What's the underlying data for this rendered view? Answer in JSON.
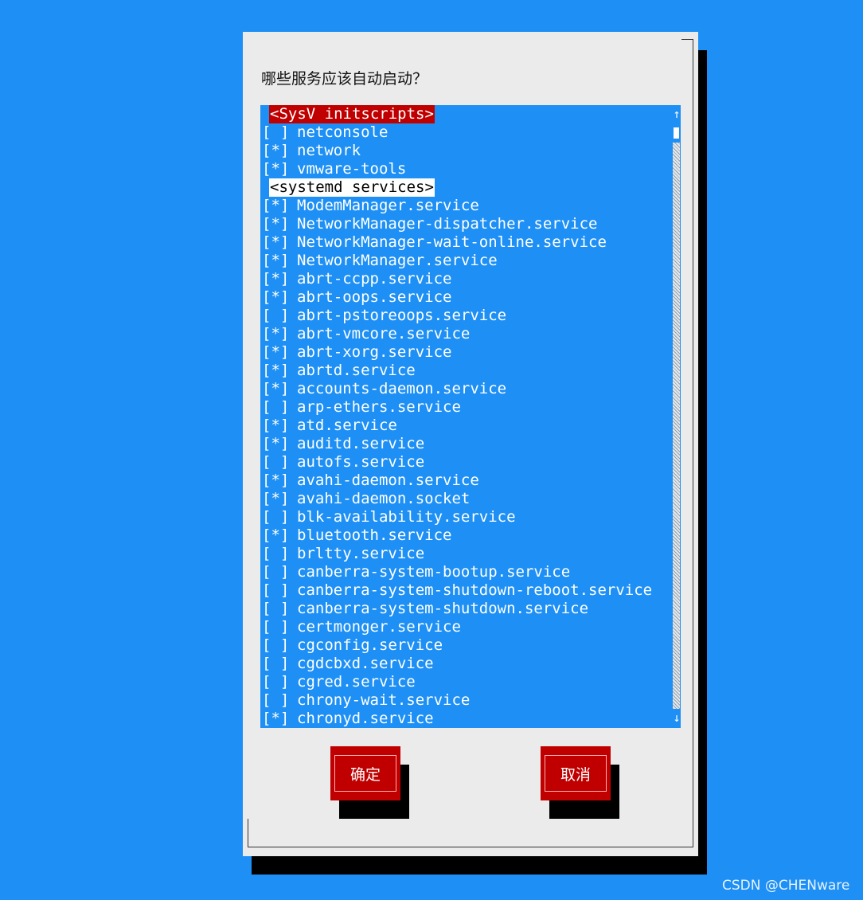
{
  "dialog": {
    "prompt": "哪些服务应该自动启动？",
    "ok_label": "确定",
    "cancel_label": "取消"
  },
  "list": {
    "groups": [
      {
        "label": "<SysV initscripts>",
        "active": true
      },
      {
        "label": "<systemd services>",
        "active": false
      }
    ],
    "sysv_items": [
      {
        "check": "[ ]",
        "name": "netconsole"
      },
      {
        "check": "[*]",
        "name": "network"
      },
      {
        "check": "[*]",
        "name": "vmware-tools"
      }
    ],
    "systemd_items": [
      {
        "check": "[*]",
        "name": "ModemManager.service"
      },
      {
        "check": "[*]",
        "name": "NetworkManager-dispatcher.service"
      },
      {
        "check": "[*]",
        "name": "NetworkManager-wait-online.service"
      },
      {
        "check": "[*]",
        "name": "NetworkManager.service"
      },
      {
        "check": "[*]",
        "name": "abrt-ccpp.service"
      },
      {
        "check": "[*]",
        "name": "abrt-oops.service"
      },
      {
        "check": "[ ]",
        "name": "abrt-pstoreoops.service"
      },
      {
        "check": "[*]",
        "name": "abrt-vmcore.service"
      },
      {
        "check": "[*]",
        "name": "abrt-xorg.service"
      },
      {
        "check": "[*]",
        "name": "abrtd.service"
      },
      {
        "check": "[*]",
        "name": "accounts-daemon.service"
      },
      {
        "check": "[ ]",
        "name": "arp-ethers.service"
      },
      {
        "check": "[*]",
        "name": "atd.service"
      },
      {
        "check": "[*]",
        "name": "auditd.service"
      },
      {
        "check": "[ ]",
        "name": "autofs.service"
      },
      {
        "check": "[*]",
        "name": "avahi-daemon.service"
      },
      {
        "check": "[*]",
        "name": "avahi-daemon.socket"
      },
      {
        "check": "[ ]",
        "name": "blk-availability.service"
      },
      {
        "check": "[*]",
        "name": "bluetooth.service"
      },
      {
        "check": "[ ]",
        "name": "brltty.service"
      },
      {
        "check": "[ ]",
        "name": "canberra-system-bootup.service"
      },
      {
        "check": "[ ]",
        "name": "canberra-system-shutdown-reboot.service"
      },
      {
        "check": "[ ]",
        "name": "canberra-system-shutdown.service"
      },
      {
        "check": "[ ]",
        "name": "certmonger.service"
      },
      {
        "check": "[ ]",
        "name": "cgconfig.service"
      },
      {
        "check": "[ ]",
        "name": "cgdcbxd.service"
      },
      {
        "check": "[ ]",
        "name": "cgred.service"
      },
      {
        "check": "[ ]",
        "name": "chrony-wait.service"
      },
      {
        "check": "[*]",
        "name": "chronyd.service"
      }
    ]
  },
  "scrollbar": {
    "up_arrow": "↑",
    "down_arrow": "↓"
  },
  "watermark": "CSDN @CHENware",
  "colors": {
    "background": "#1e90f5",
    "dialog": "#ebebeb",
    "accent": "#c00000"
  }
}
